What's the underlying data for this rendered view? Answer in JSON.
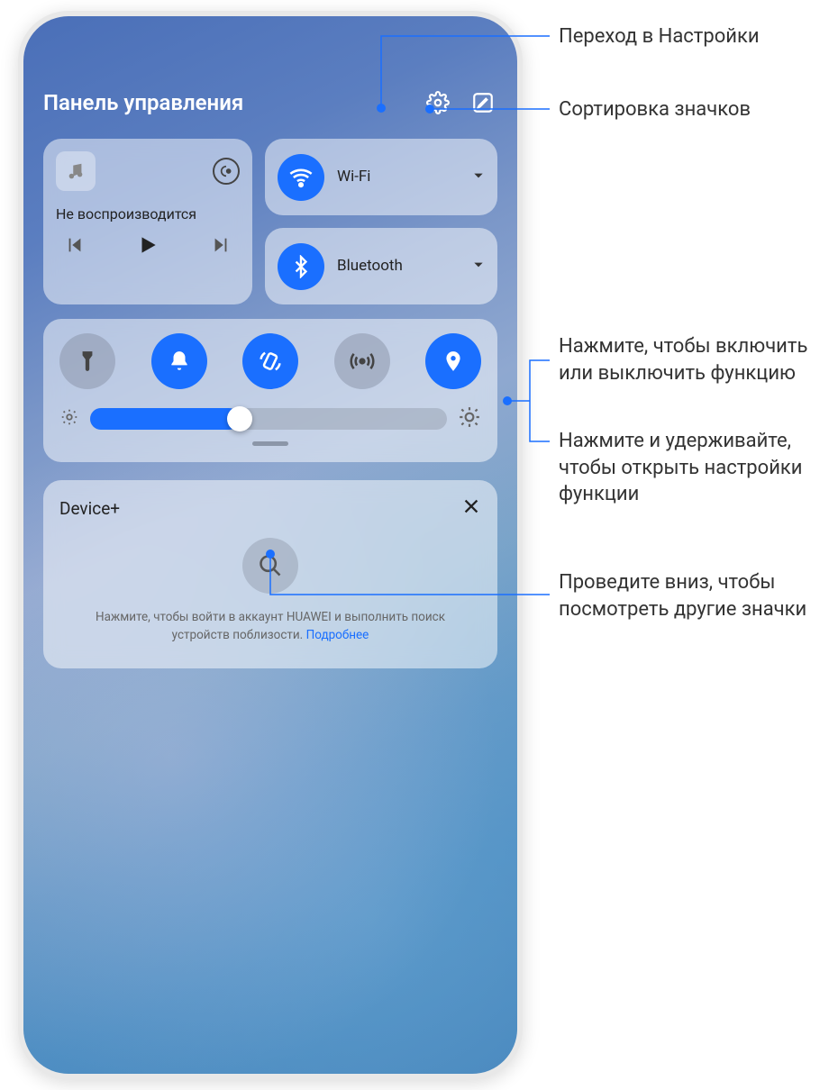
{
  "header": {
    "title": "Панель управления"
  },
  "music": {
    "status": "Не воспроизводится"
  },
  "network": {
    "wifi": "Wi-Fi",
    "bluetooth": "Bluetooth"
  },
  "brightness": {
    "value_percent": 42
  },
  "device_plus": {
    "title": "Device+",
    "hint": "Нажмите, чтобы войти в аккаунт HUAWEI и выполнить поиск устройств поблизости. ",
    "link": "Подробнее"
  },
  "annotations": {
    "settings": "Переход в Настройки",
    "sort": "Сортировка значков",
    "toggle_tap": "Нажмите, чтобы включить или выключить функцию",
    "toggle_hold": "Нажмите и удерживайте, чтобы открыть настройки функции",
    "swipe": "Проведите вниз, чтобы посмотреть другие значки"
  }
}
